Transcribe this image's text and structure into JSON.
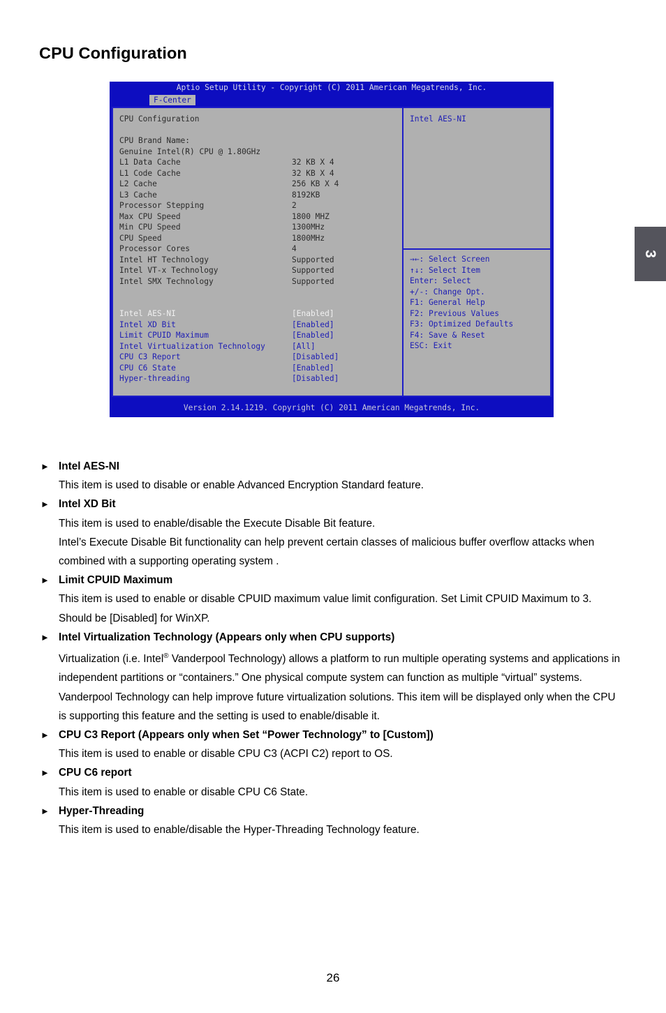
{
  "page": {
    "title": "CPU Configuration",
    "number": "26",
    "chapter_tab": "3"
  },
  "bios": {
    "titlebar": "Aptio Setup Utility - Copyright (C) 2011 American Megatrends, Inc.",
    "active_tab": "F-Center",
    "section_heading": "CPU Configuration",
    "brand_label": "CPU Brand Name:",
    "brand_value": "Genuine Intel(R) CPU @ 1.80GHz",
    "info_rows": [
      {
        "label": "L1 Data Cache",
        "value": "32 KB X 4"
      },
      {
        "label": "L1 Code Cache",
        "value": "32 KB X 4"
      },
      {
        "label": "L2 Cache",
        "value": "256 KB X 4"
      },
      {
        "label": "L3 Cache",
        "value": "8192KB"
      },
      {
        "label": "Processor Stepping",
        "value": "2"
      },
      {
        "label": "Max CPU Speed",
        "value": "1800 MHZ"
      },
      {
        "label": "Min CPU Speed",
        "value": "1300MHz"
      },
      {
        "label": "CPU Speed",
        "value": "1800MHz"
      },
      {
        "label": "Processor Cores",
        "value": "4"
      },
      {
        "label": "Intel HT Technology",
        "value": "Supported"
      },
      {
        "label": "Intel VT-x Technology",
        "value": "Supported"
      },
      {
        "label": "Intel SMX Technology",
        "value": "Supported"
      }
    ],
    "setting_rows": [
      {
        "label": "Intel AES-NI",
        "value": "[Enabled]",
        "selected": true
      },
      {
        "label": "Intel XD Bit",
        "value": "[Enabled]",
        "selected": false
      },
      {
        "label": "Limit CPUID Maximum",
        "value": "[Enabled]",
        "selected": false
      },
      {
        "label": "Intel Virtualization Technology",
        "value": "[All]",
        "selected": false
      },
      {
        "label": "CPU C3 Report",
        "value": "[Disabled]",
        "selected": false
      },
      {
        "label": "CPU C6 State",
        "value": "[Enabled]",
        "selected": false
      },
      {
        "label": "Hyper-threading",
        "value": "[Disabled]",
        "selected": false
      }
    ],
    "help_title": "Intel AES-NI",
    "help_keys": [
      "→←: Select Screen",
      "↑↓: Select Item",
      "Enter: Select",
      "+/-: Change Opt.",
      "F1: General Help",
      "F2: Previous Values",
      "F3: Optimized Defaults",
      "F4: Save & Reset",
      "ESC: Exit"
    ],
    "footer": "Version 2.14.1219. Copyright (C) 2011 American Megatrends, Inc.",
    "colors": {
      "window_blue": "#0d0dc0",
      "panel_gray": "#b0b0b0",
      "border_blue": "#1e1ec8",
      "label_blue": "#2020b4"
    }
  },
  "doc": {
    "bullet": "►",
    "entries": [
      {
        "heading": "Intel AES-NI",
        "paragraphs": [
          "This item is used to disable or enable Advanced Encryption Standard feature."
        ]
      },
      {
        "heading": "Intel XD Bit",
        "paragraphs": [
          "This item is used to enable/disable the Execute Disable Bit feature.",
          "Intel’s Execute Disable Bit functionality can help prevent certain classes of malicious buffer overflow attacks when combined with a supporting operating system ."
        ]
      },
      {
        "heading": "Limit CPUID Maximum",
        "paragraphs": [
          "This item is used to enable or disable CPUID maximum value limit configuration. Set Limit CPUID Maximum to 3. Should be [Disabled] for WinXP."
        ]
      },
      {
        "heading": "Intel Virtualization Technology  (Appears only when CPU supports)",
        "paragraphs": [],
        "html_paragraphs": [
          "Virtualization (i.e. Intel<sup>®</sup> Vanderpool Technology) allows a platform to run multiple operating systems and applications in independent partitions or “containers.” One physical compute system can function as multiple “virtual” systems. Vanderpool Technology can help improve future virtualization solutions. This item will be displayed only when the CPU is supporting this feature and the setting is used to enable/disable it."
        ]
      },
      {
        "heading": "CPU C3 Report (Appears only when Set “Power Technology” to [Custom])",
        "paragraphs": [
          "This item is used to enable or disable CPU C3 (ACPI C2) report to OS."
        ]
      },
      {
        "heading": "CPU C6 report",
        "paragraphs": [
          "This item is used to enable or disable CPU C6 State."
        ]
      },
      {
        "heading": "Hyper-Threading",
        "paragraphs": [
          "This item is used to enable/disable the Hyper-Threading Technology feature."
        ]
      }
    ]
  }
}
